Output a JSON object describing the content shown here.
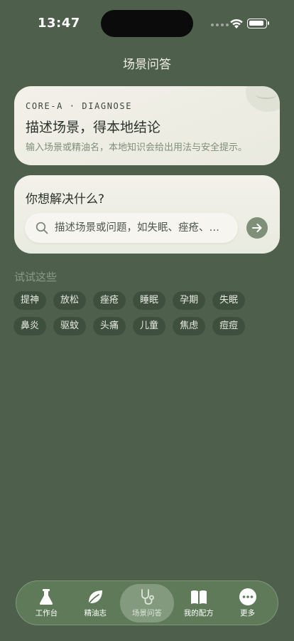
{
  "status_bar": {
    "time": "13:47"
  },
  "nav": {
    "title": "场景问答"
  },
  "intro_card": {
    "tag": "CORE-A · DIAGNOSE",
    "title": "描述场景，得本地结论",
    "description": "输入场景或精油名，本地知识会给出用法与安全提示。"
  },
  "ask_card": {
    "title": "你想解决什么?",
    "search_placeholder": "描述场景或问题，如失眠、痤疮、…",
    "search_value": "",
    "submit_icon": "arrow-right-icon"
  },
  "suggestions": {
    "title": "试试这些",
    "chips": [
      "提神",
      "放松",
      "痤疮",
      "睡眠",
      "孕期",
      "失眠",
      "鼻炎",
      "驱蚊",
      "头痛",
      "儿童",
      "焦虑",
      "痘痘"
    ]
  },
  "tab_bar": {
    "active": "场景问答",
    "tabs": [
      {
        "label": "工作台",
        "icon": "flask-icon"
      },
      {
        "label": "精油志",
        "icon": "leaf-icon"
      },
      {
        "label": "场景问答",
        "icon": "stethoscope-icon"
      },
      {
        "label": "我的配方",
        "icon": "book-icon"
      },
      {
        "label": "更多",
        "icon": "more-icon"
      }
    ]
  },
  "colors": {
    "background": "#4e604c",
    "card": "#f3f0e9",
    "accent": "#7f8f78",
    "chip": "#3e4f3d",
    "tab_bar": "#5f7a59"
  }
}
